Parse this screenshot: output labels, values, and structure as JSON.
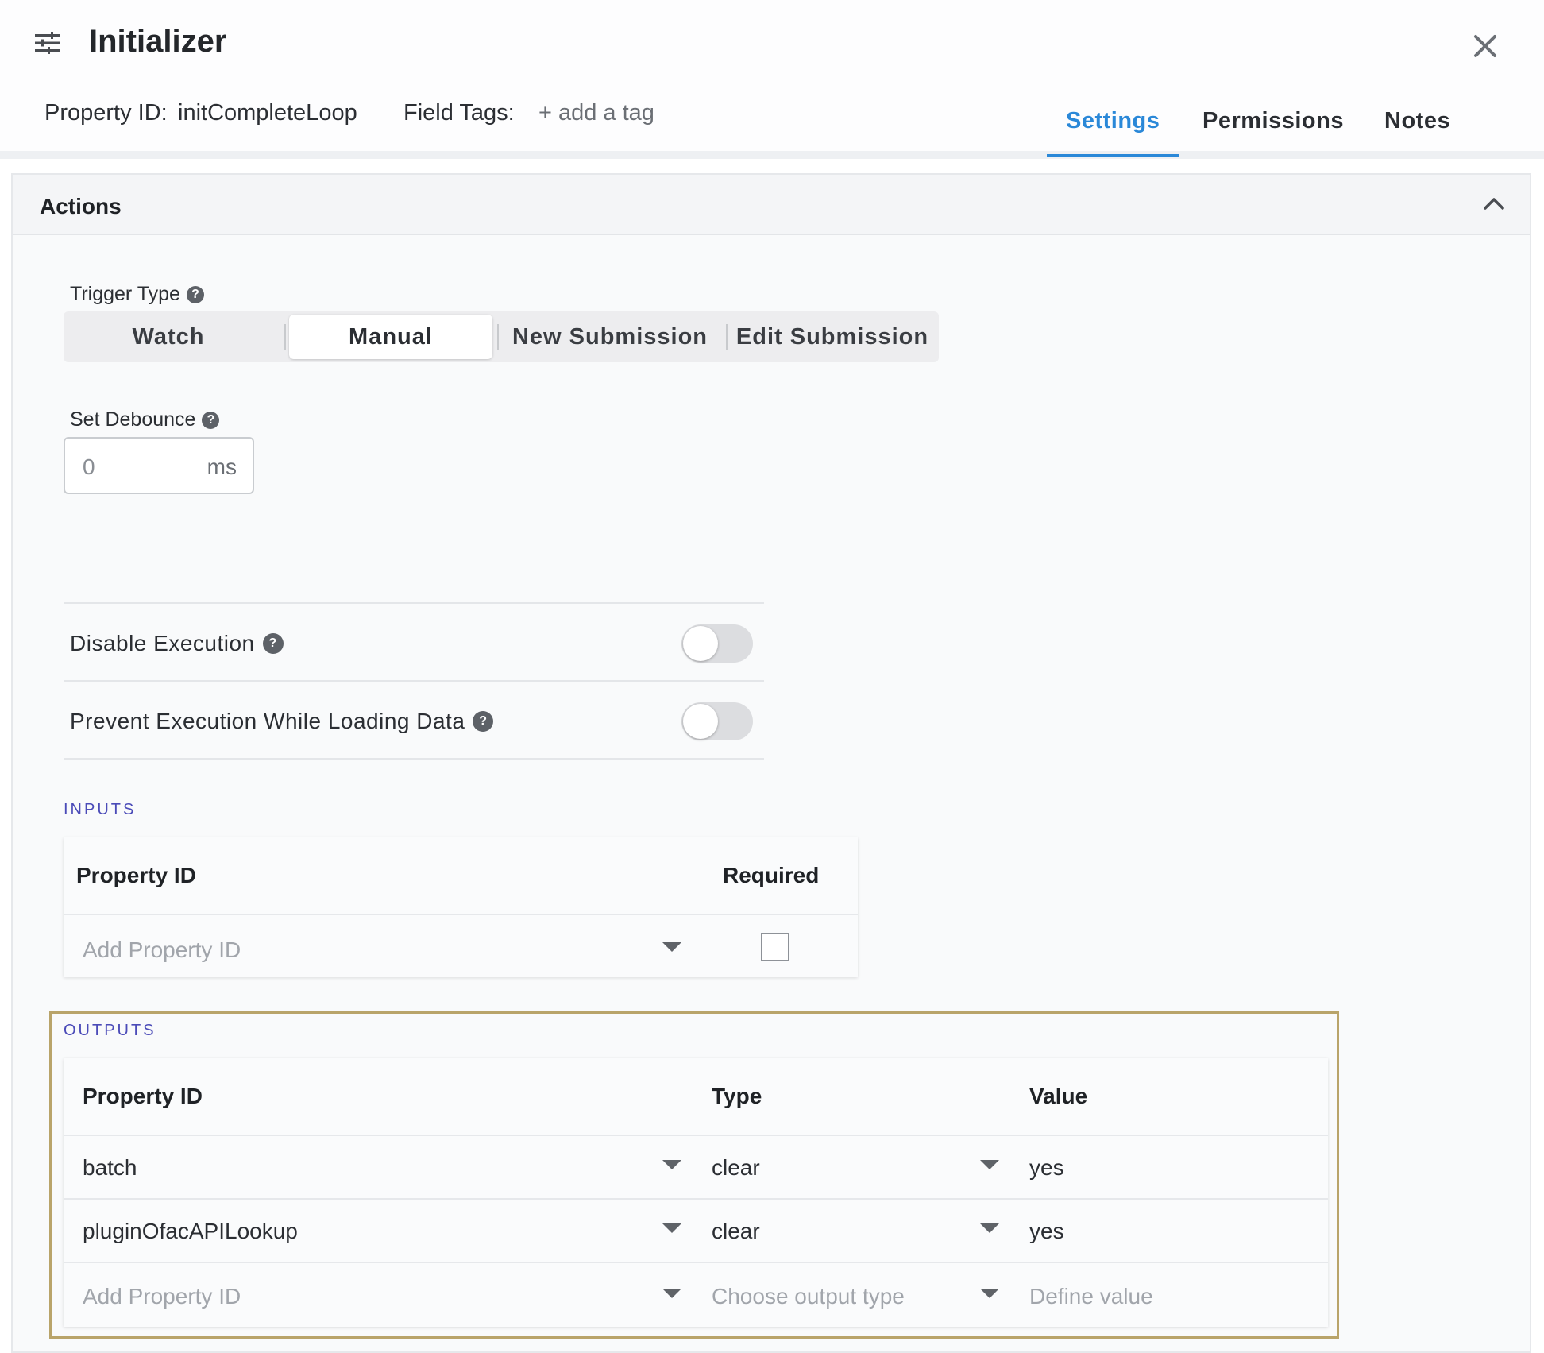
{
  "header": {
    "title": "Initializer",
    "property_id_label": "Property ID:",
    "property_id_value": "initCompleteLoop",
    "field_tags_label": "Field Tags:",
    "add_tag": "+ add a tag",
    "tabs": [
      {
        "label": "Settings",
        "active": true
      },
      {
        "label": "Permissions",
        "active": false
      },
      {
        "label": "Notes",
        "active": false
      }
    ]
  },
  "actions": {
    "title": "Actions",
    "trigger_type": {
      "label": "Trigger Type",
      "options": [
        "Watch",
        "Manual",
        "New Submission",
        "Edit Submission"
      ],
      "selected": "Manual"
    },
    "debounce": {
      "label": "Set Debounce",
      "value": "0",
      "unit": "ms"
    },
    "disable_execution": {
      "label": "Disable Execution",
      "enabled": false
    },
    "prevent_execution": {
      "label": "Prevent Execution While Loading Data",
      "enabled": false
    }
  },
  "inputs": {
    "section_label": "INPUTS",
    "columns": [
      "Property ID",
      "Required"
    ],
    "new_row": {
      "property_placeholder": "Add Property ID",
      "required": false
    }
  },
  "outputs": {
    "section_label": "OUTPUTS",
    "columns": [
      "Property ID",
      "Type",
      "Value"
    ],
    "rows": [
      {
        "property_id": "batch",
        "type": "clear",
        "value": "yes"
      },
      {
        "property_id": "pluginOfacAPILookup",
        "type": "clear",
        "value": "yes"
      }
    ],
    "new_row": {
      "property_placeholder": "Add Property ID",
      "type_placeholder": "Choose output type",
      "value_placeholder": "Define value"
    }
  },
  "icons": {
    "menu": "sliders-icon",
    "close": "close-icon",
    "collapse": "chevron-up-icon",
    "help": "help-circle-icon",
    "dropdown": "caret-down-icon"
  },
  "colors": {
    "accent": "#2a88d8",
    "section_label": "#4b4bb8",
    "highlight_frame": "#b9a46a"
  }
}
